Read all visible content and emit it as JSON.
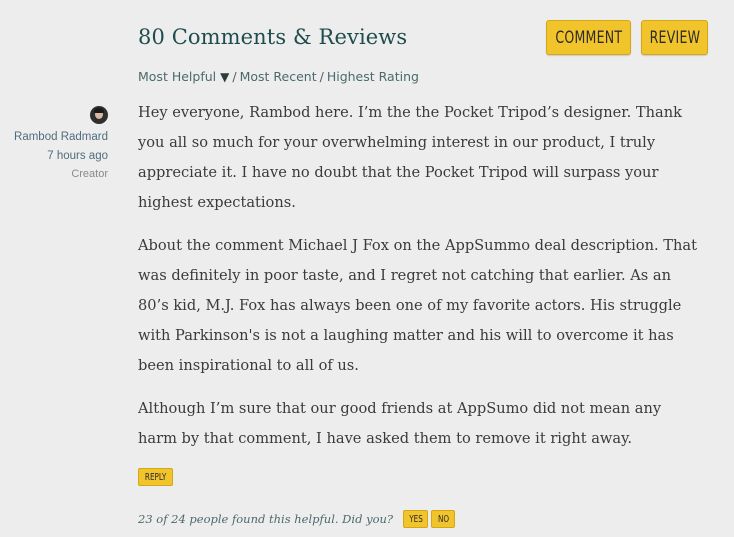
{
  "header": {
    "title": "80 Comments & Reviews",
    "comment_button": "COMMENT",
    "review_button": "REVIEW"
  },
  "sort": {
    "most_helpful": "Most Helpful",
    "most_helpful_arrow": "▼",
    "separator": "/",
    "most_recent": "Most Recent",
    "highest_rating": "Highest Rating"
  },
  "comment": {
    "author": "Rambod Radmard",
    "time": "7 hours ago",
    "role": "Creator",
    "paragraphs": [
      "Hey everyone, Rambod here. I’m the the Pocket Tripod’s designer. Thank you all so much for your overwhelming interest in our product, I truly appreciate it. I have no doubt that the Pocket Tripod will surpass your highest expectations.",
      "About the comment Michael J Fox on the AppSummo deal description. That was definitely in poor taste, and I regret not catching that earlier. As an 80’s kid, M.J. Fox has always been one of my favorite actors. His struggle with Parkinson's is not a laughing matter and his will to overcome it has been inspirational to all of us.",
      "Although I’m sure that our good friends at AppSumo did not mean any harm by that comment, I have asked them to remove it right away."
    ],
    "reply_label": "REPLY",
    "helpful_text": "23 of 24 people found this helpful. Did you?",
    "yes_label": "YES",
    "no_label": "NO"
  },
  "colors": {
    "background": "#ededed",
    "accent_button": "#f2c42b",
    "title": "#1f4d4d",
    "link": "#4a6a6a"
  },
  "icons": {
    "sort_arrow": "triangle-down-icon",
    "avatar": "user-photo"
  }
}
